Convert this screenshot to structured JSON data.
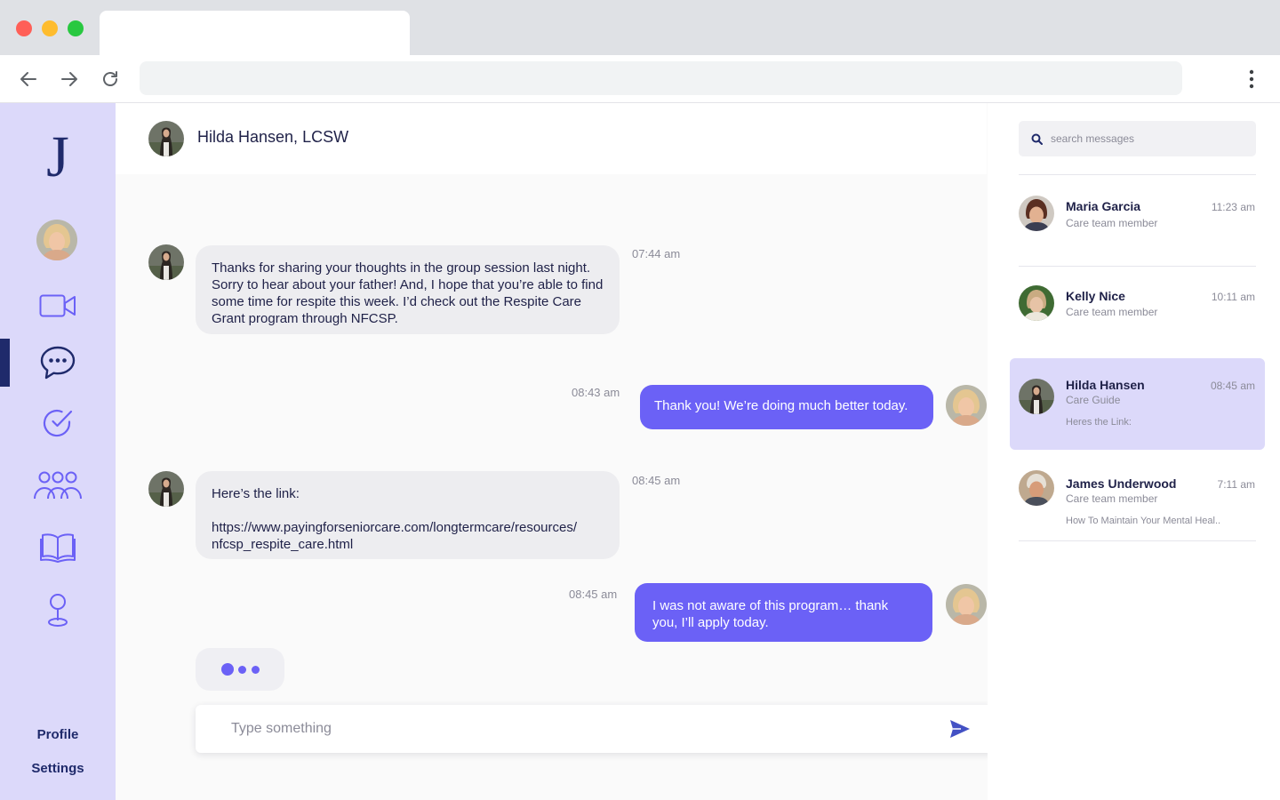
{
  "browser": {
    "url": ""
  },
  "nav": {
    "logo": "J",
    "items": [
      "video",
      "messages",
      "tasks",
      "community",
      "resources",
      "location"
    ],
    "active": "messages",
    "profile_label": "Profile",
    "settings_label": "Settings"
  },
  "chat": {
    "contact_name": "Hilda Hansen, LCSW",
    "messages": [
      {
        "from": "them",
        "time": "07:44 am",
        "text": "Thanks for sharing your thoughts in the group session last night. Sorry to hear about your father! And, I hope that you’re able to find some time for respite this week. I’d check out the Respite Care Grant program through NFCSP."
      },
      {
        "from": "me",
        "time": "08:43 am",
        "text": "Thank you! We’re doing much better today."
      },
      {
        "from": "them",
        "time": "08:45 am",
        "text_line1": "Here’s the link:",
        "text_line2": "https://www.payingforseniorcare.com/longtermcare/resources/ nfcsp_respite_care.html"
      },
      {
        "from": "me",
        "time": "08:45 am",
        "text": "I was not aware of this program… thank you, I’ll apply today."
      }
    ],
    "composer_placeholder": "Type something"
  },
  "sidebar": {
    "search_placeholder": "search messages",
    "contacts": [
      {
        "name": "Maria Garcia",
        "role": "Care team member",
        "time": "11:23 am",
        "preview": ""
      },
      {
        "name": "Kelly Nice",
        "role": "Care team member",
        "time": "10:11 am",
        "preview": ""
      },
      {
        "name": "Hilda Hansen",
        "role": "Care Guide",
        "time": "08:45 am",
        "preview": "Heres the Link:"
      },
      {
        "name": "James Underwood",
        "role": "Care team member",
        "time": "7:11 am",
        "preview": "How To Maintain Your Mental Heal.."
      }
    ],
    "active_index": 2
  },
  "colors": {
    "accent": "#6b61f6",
    "nav_bg": "#dcd9fa",
    "navy": "#1f2a6b"
  }
}
